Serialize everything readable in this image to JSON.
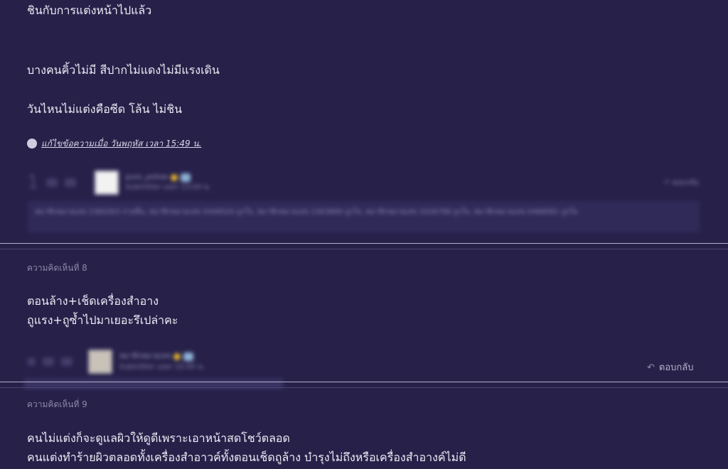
{
  "comment7": {
    "lines": [
      "ชินกับการแต่งหน้าไปแล้ว",
      "บางคนคิ้วไม่มี สีปากไม่แดงไม่มีแรงเดิน",
      "วันไหนไม่แต่งคือซีด โล้น ไม่ชิน"
    ],
    "edit_note": "แก้ไขข้อความเมื่อ วันพฤหัส เวลา 15:49 น.",
    "vote_count": "1",
    "user_name": "pure_yellow",
    "user_sub": "Submitter user 13:04 น.",
    "reply_label": "ตอบกลับ",
    "signature": "สมาชิกหมายเลข 2360303 ถ่ายชื่น, สมาชิกหมายเลข 5449520 ถูกใจ, สมาชิกหมายเลข 2363869 ถูกใจ, สมาชิกหมายเลข 1026798 ถูกใจ, สมาชิกหมายเลข 0468581 ถูกใจ"
  },
  "comment8": {
    "label": "ความคิดเห็นที่ 8",
    "lines": [
      "ตอนล้าง+เช็ดเครื่องสำอาง",
      "ถูแรง+ถูซ้ำไปมาเยอะรึเปล่าคะ"
    ],
    "user_name": "สมาชิกหมายเลข",
    "user_sub": "Submitter user 15:45 น.",
    "reply_label": "ตอบกลับ"
  },
  "comment9": {
    "label": "ความคิดเห็นที่ 9",
    "lines": [
      "คนไม่แต่งก็จะดูแลผิวให้ดูดีเพราะเอาหน้าสดโชว์ตลอด",
      "คนแต่งทำร้ายผิวตลอดทั้งเครื่องสำอาวค์ทั้งตอนเช็ดถูล้าง บำรุงไม่ถึงหรือเครื่องสำอางค์ไม่ดี"
    ]
  },
  "colors": {
    "background": "#27214a",
    "divider": "#b2aec9",
    "text": "#ecebf3",
    "muted": "#8c88a8"
  },
  "icons": [
    "edit-icon",
    "thumb-up-icon",
    "emoji-icon",
    "reply-arrow-icon",
    "star-badge-icon",
    "member-badge-icon"
  ]
}
